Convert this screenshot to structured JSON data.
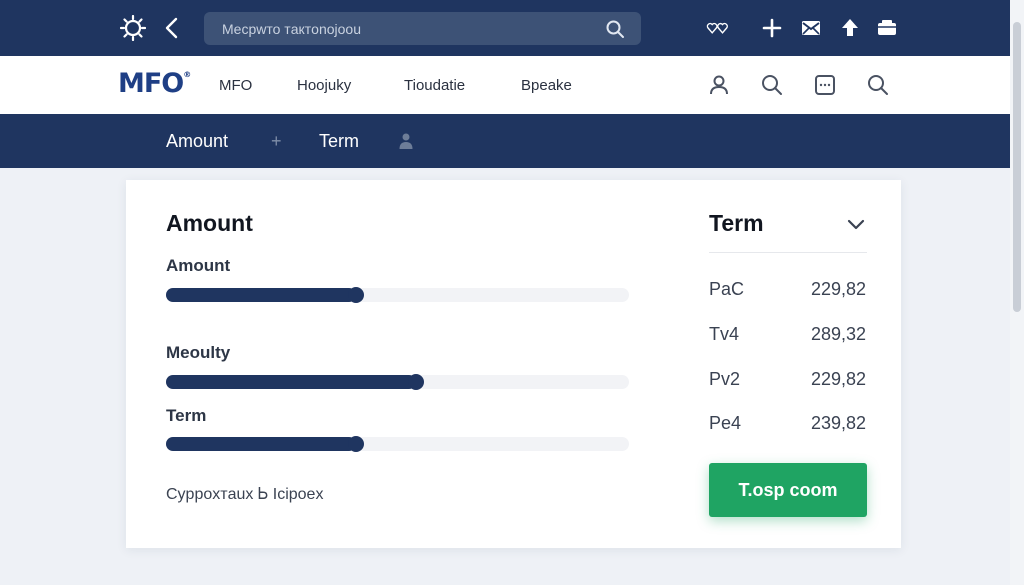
{
  "topbar": {
    "search_placeholder": "Mecpwто тaктonojoou",
    "icons": [
      "sun-icon",
      "back-arrow-icon",
      "search-icon",
      "heart-icon",
      "plus-icon",
      "mail-icon",
      "upload-icon",
      "wallet-icon"
    ]
  },
  "navbar": {
    "logo": "MFO",
    "links": [
      "MFO",
      "Hoojuky",
      "Tioudatie",
      "Bpeake"
    ],
    "icons": [
      "user-icon",
      "search-icon",
      "chat-icon",
      "search-icon"
    ]
  },
  "subbar": {
    "tab_amount": "Amount",
    "separator": "+",
    "tab_term": "Term"
  },
  "card": {
    "title": "Amount",
    "sliders": [
      {
        "label": "Amount",
        "value_fraction": 0.41
      },
      {
        "label": "Meoulty",
        "value_fraction": 0.54
      },
      {
        "label": "Term",
        "value_fraction": 0.41
      }
    ],
    "footnote": "Cyppoxтaux Ꮟ Icipoex",
    "term": {
      "title": "Term",
      "rows": [
        {
          "key": "PaC",
          "value": "229,82"
        },
        {
          "key": "Tv4",
          "value": "289,32"
        },
        {
          "key": "Pv2",
          "value": "229,82"
        },
        {
          "key": "Pe4",
          "value": "239,82"
        }
      ]
    },
    "cta_label": "T.osp coom"
  },
  "colors": {
    "brand_navy": "#1f3560",
    "accent_green": "#1fa463",
    "logo_blue": "#1f3f85"
  }
}
